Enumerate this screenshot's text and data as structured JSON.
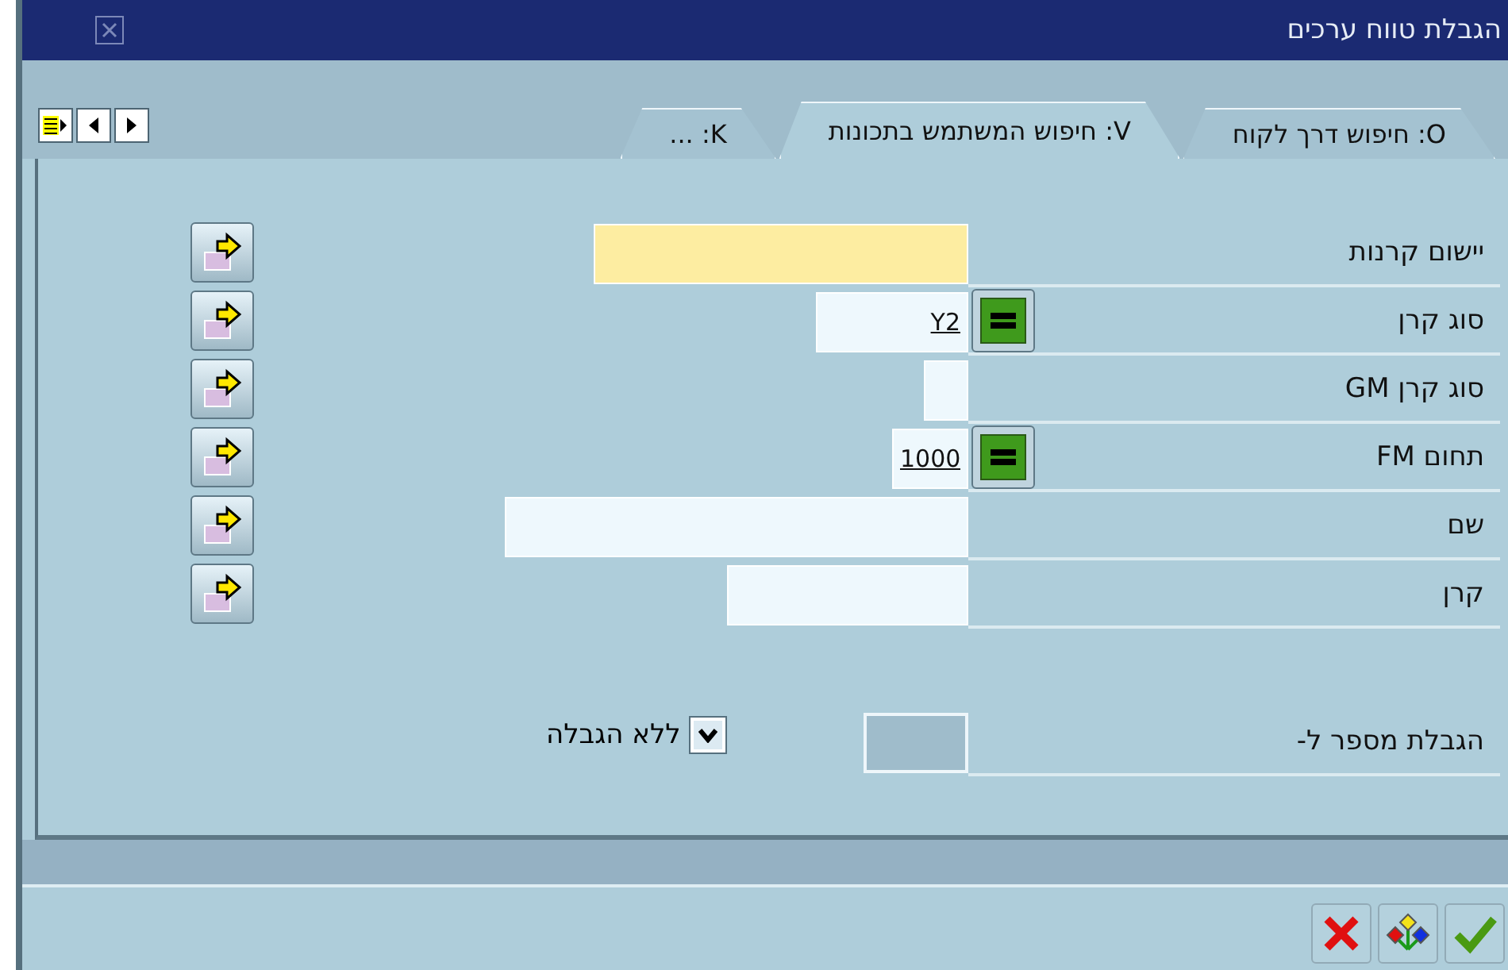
{
  "window": {
    "title": "הגבלת טווח ערכים"
  },
  "tabs": [
    {
      "label": "O: חיפוש דרך לקוח",
      "selected": false
    },
    {
      "label": "V: חיפוש המשתמש בתכונות",
      "selected": true
    },
    {
      "label": "K: ...",
      "selected": false
    }
  ],
  "fields": [
    {
      "label": "יישום קרנות",
      "required": true,
      "has_option": false
    },
    {
      "label": "סוג קרן",
      "value": "Y2",
      "required": false,
      "has_option": true
    },
    {
      "label": "סוג קרן GM",
      "required": false,
      "has_option": false
    },
    {
      "label": "תחום FM",
      "value": "1000",
      "required": false,
      "has_option": true
    },
    {
      "label": "שם",
      "required": false,
      "has_option": false
    },
    {
      "label": "קרן",
      "required": false,
      "has_option": false
    }
  ],
  "limit": {
    "label": "הגבלת מספר ל-",
    "checkbox": {
      "label": "ללא הגבלה",
      "checked": true
    }
  }
}
